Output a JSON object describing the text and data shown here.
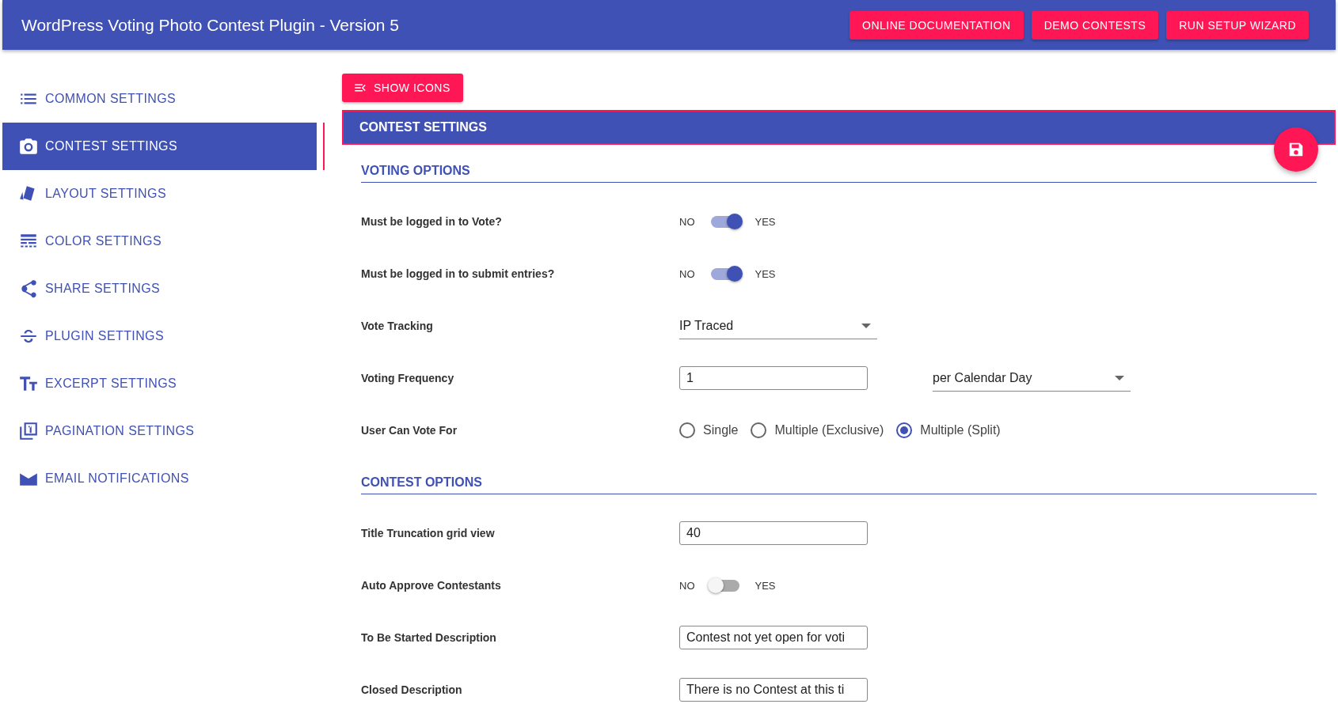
{
  "header": {
    "title": "WordPress Voting Photo Contest Plugin - Version 5",
    "buttons": [
      "ONLINE DOCUMENTATION",
      "DEMO CONTESTS",
      "RUN SETUP WIZARD"
    ]
  },
  "sidebar": {
    "items": [
      {
        "label": "COMMON SETTINGS",
        "kind": "list",
        "selected": false
      },
      {
        "label": "CONTEST SETTINGS",
        "kind": "camera",
        "selected": true
      },
      {
        "label": "LAYOUT SETTINGS",
        "kind": "swatch",
        "selected": false
      },
      {
        "label": "COLOR SETTINGS",
        "kind": "lines",
        "selected": false
      },
      {
        "label": "SHARE SETTINGS",
        "kind": "share",
        "selected": false
      },
      {
        "label": "PLUGIN SETTINGS",
        "kind": "strike",
        "selected": false
      },
      {
        "label": "EXCERPT SETTINGS",
        "kind": "text",
        "selected": false
      },
      {
        "label": "PAGINATION SETTINGS",
        "kind": "page",
        "selected": false
      },
      {
        "label": "EMAIL NOTIFICATIONS",
        "kind": "mail",
        "selected": false
      }
    ]
  },
  "show_icons_button": "SHOW ICONS",
  "panel_title": "CONTEST SETTINGS",
  "rows": [
    {
      "kind": "section",
      "label": "VOTING OPTIONS"
    },
    {
      "kind": "toggle",
      "label": "Must be logged in to Vote?",
      "off_label": "NO",
      "on_label": "YES",
      "on": true
    },
    {
      "kind": "toggle",
      "label": "Must be logged in to submit entries?",
      "off_label": "NO",
      "on_label": "YES",
      "on": true
    },
    {
      "kind": "select",
      "label": "Vote Tracking",
      "value": "IP Traced"
    },
    {
      "kind": "number_select",
      "label": "Voting Frequency",
      "value": "1",
      "select_value": "per Calendar Day"
    },
    {
      "kind": "radio",
      "label": "User Can Vote For",
      "options": [
        {
          "label": "Single",
          "selected": false
        },
        {
          "label": "Multiple (Exclusive)",
          "selected": false
        },
        {
          "label": "Multiple (Split)",
          "selected": true
        }
      ]
    },
    {
      "kind": "section",
      "label": "CONTEST OPTIONS"
    },
    {
      "kind": "text",
      "label": "Title Truncation grid view",
      "value": "40"
    },
    {
      "kind": "toggle",
      "label": "Auto Approve Contestants",
      "off_label": "NO",
      "on_label": "YES",
      "on": false
    },
    {
      "kind": "text",
      "label": "To Be Started Description",
      "value": "Contest not yet open for voti"
    },
    {
      "kind": "text",
      "label": "Closed Description",
      "value": "There is no Contest at this ti"
    }
  ]
}
